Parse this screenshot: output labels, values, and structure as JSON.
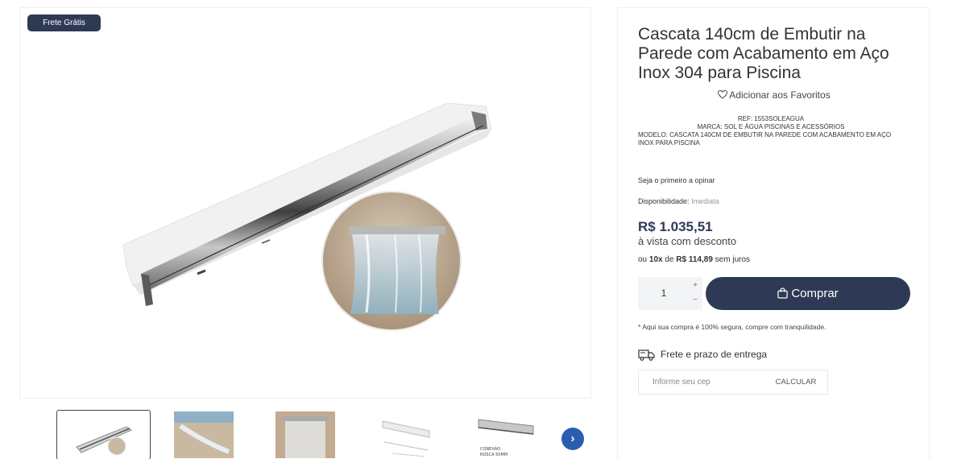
{
  "gallery": {
    "badge": "Frete Grátis",
    "thumb_texts": {
      "t4_label": "CONEXÃO\nROSCA 50MM"
    }
  },
  "product": {
    "title": "Cascata 140cm de Embutir na Parede com Acabamento em Aço Inox 304 para Piscina",
    "favorite_label": "Adicionar aos Favoritos",
    "ref": "REF:  1553SOLEAGUA",
    "brand": "MARCA: SOL E ÁGUA PISCINAS E ACESSÓRIOS",
    "model": "MODELO: CASCATA 140CM DE EMBUTIR NA PAREDE COM ACABAMENTO EM AÇO INOX PARA PISCINA",
    "review_label": "Seja o primeiro a opinar",
    "availability_label": "Disponibilidade:",
    "availability_value": "Imediata",
    "price": "R$ 1.035,51",
    "cash_note": "à vista com desconto",
    "installments_prefix": "ou",
    "installments_count": "10x",
    "installments_mid": "de",
    "installments_value": "R$ 114,89",
    "installments_suffix": "sem juros",
    "quantity": "1",
    "qty_plus": "+",
    "qty_minus": "−",
    "buy_label": "Comprar",
    "secure_note": "* Aqui sua compra é 100% segura, compre com tranquilidade.",
    "shipping_title": "Frete e prazo de entrega",
    "cep_placeholder": "Informe seu cep",
    "calc_label": "CALCULAR",
    "next_arrow": "›"
  },
  "colors": {
    "brand": "#2e3a55",
    "next": "#2a5db0"
  },
  "icons": [
    "heart-outline-icon",
    "shopping-bag-icon",
    "truck-icon",
    "chevron-right-icon"
  ]
}
